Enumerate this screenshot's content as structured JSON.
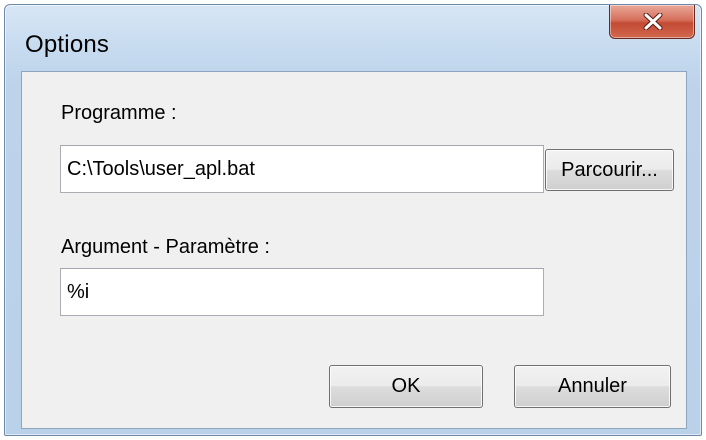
{
  "window": {
    "title": "Options",
    "close_icon": "close-icon"
  },
  "program": {
    "label": "Programme :",
    "value": "C:\\Tools\\user_apl.bat",
    "browse_label": "Parcourir..."
  },
  "argument": {
    "label": "Argument - Paramètre :",
    "value": "%i"
  },
  "buttons": {
    "ok_label": "OK",
    "cancel_label": "Annuler"
  },
  "colors": {
    "close_button": "#c34a33",
    "frame": "#c8dcf0",
    "client_background": "#f0f0f0"
  }
}
